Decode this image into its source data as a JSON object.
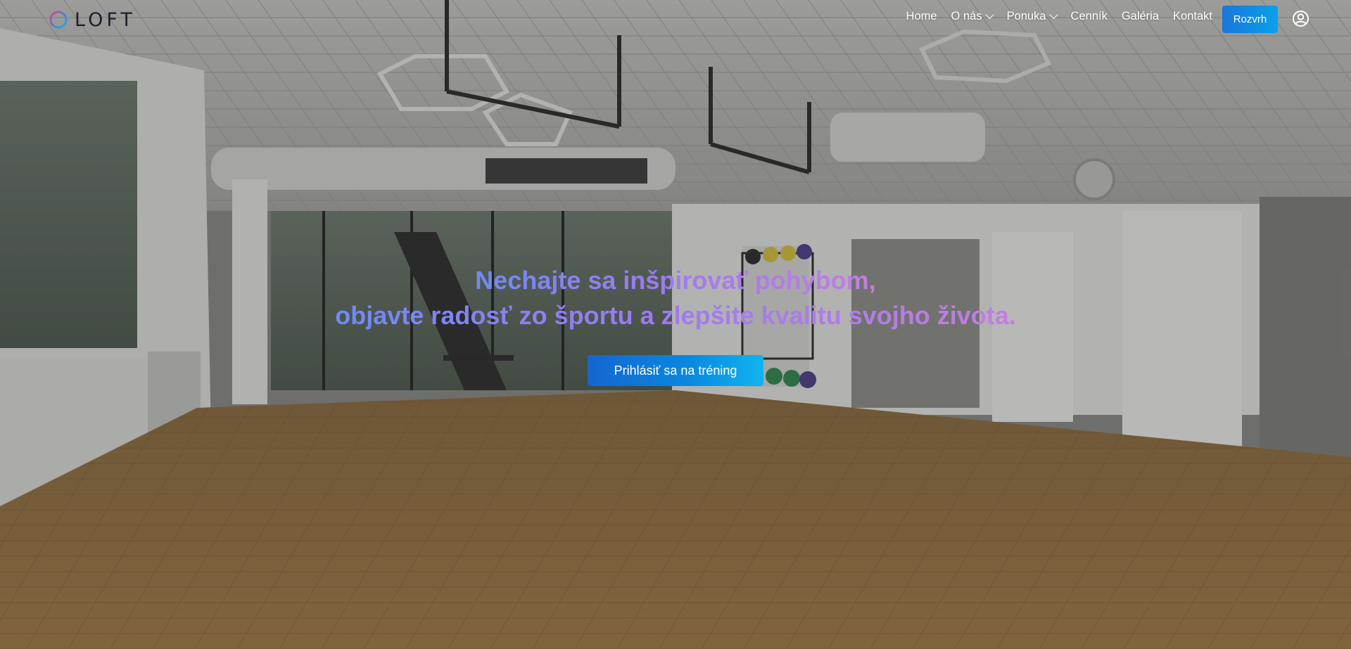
{
  "brand": {
    "name": "LOFT"
  },
  "nav": {
    "items": [
      {
        "label": "Home",
        "has_dropdown": false
      },
      {
        "label": "O nás",
        "has_dropdown": true
      },
      {
        "label": "Ponuka",
        "has_dropdown": true
      },
      {
        "label": "Cenník",
        "has_dropdown": false
      },
      {
        "label": "Galéria",
        "has_dropdown": false
      },
      {
        "label": "Kontakt",
        "has_dropdown": false
      }
    ],
    "schedule_button": "Rozvrh",
    "account_icon": "user-circle-icon"
  },
  "hero": {
    "headline_line1": "Nechajte sa inšpirovať pohybom,",
    "headline_line2": "objavte radosť zo športu a zlepšite kvalitu svojho života.",
    "cta_label": "Prihlásiť sa na tréning"
  },
  "colors": {
    "accent_blue": "#1976d8",
    "cta_gradient_end": "#10b4ef",
    "headline_gradient": [
      "#6f8bf5",
      "#9b7bf0",
      "#c27ee0"
    ]
  }
}
